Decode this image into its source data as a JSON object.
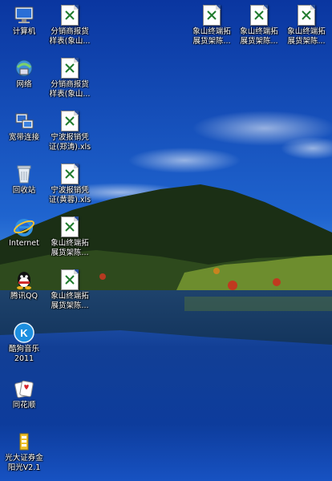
{
  "desktop": {
    "icons": [
      {
        "label": "计算机",
        "icon": "computer-icon"
      },
      {
        "label": "网络",
        "icon": "network-icon"
      },
      {
        "label": "宽带连接",
        "icon": "broadband-icon"
      },
      {
        "label": "回收站",
        "icon": "recycle-bin-icon"
      },
      {
        "label": "Internet",
        "icon": "internet-explorer-icon"
      },
      {
        "label": "腾讯QQ",
        "icon": "qq-icon"
      },
      {
        "label": "酷狗音乐\n2011",
        "icon": "kugou-icon"
      },
      {
        "label": "同花顺",
        "icon": "tonghuashun-icon"
      },
      {
        "label": "光大证券金\n阳光V2.1",
        "icon": "guangda-icon"
      },
      {
        "label": "分销商报货\n样表(象山...",
        "icon": "excel-file-icon"
      },
      {
        "label": "分销商报货\n样表(象山...",
        "icon": "excel-file-icon"
      },
      {
        "label": "宁波报销凭\n证(郑涛).xls",
        "icon": "excel-file-icon"
      },
      {
        "label": "宁波报销凭\n证(黄蓉).xls",
        "icon": "excel-file-icon"
      },
      {
        "label": "象山终端拓\n展货架陈...",
        "icon": "excel-file-icon"
      },
      {
        "label": "象山终端拓\n展货架陈...",
        "icon": "excel-file-icon"
      },
      {
        "label": "象山终端拓\n展货架陈...",
        "icon": "excel-file-icon"
      },
      {
        "label": "象山终端拓\n展货架陈...",
        "icon": "excel-file-icon"
      },
      {
        "label": "象山终端拓\n展货架陈...",
        "icon": "excel-file-icon"
      }
    ]
  },
  "colors": {
    "sky_top": "#0b3fa6",
    "sky_bottom": "#3d8be0",
    "water": "#0d3a8c",
    "forest": "#152a12"
  }
}
